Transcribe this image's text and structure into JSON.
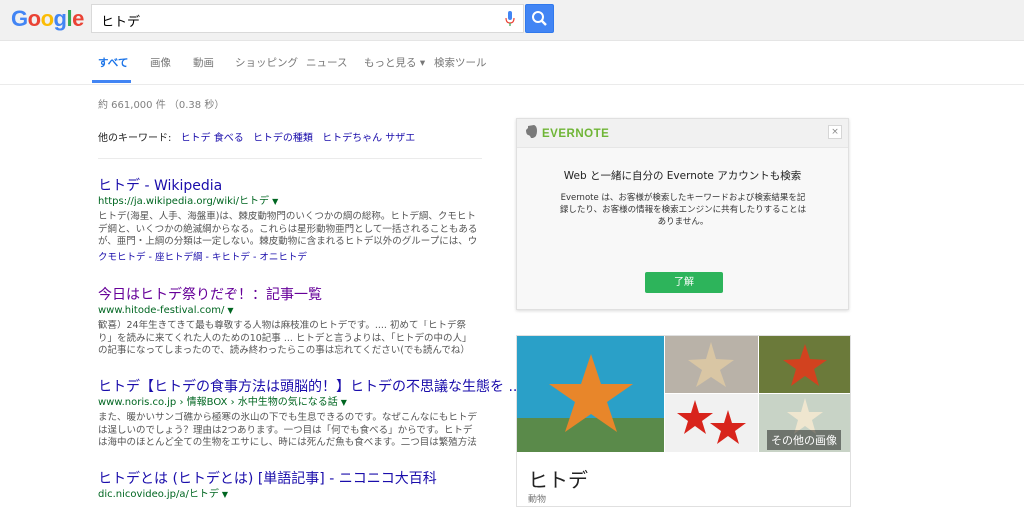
{
  "logo_letters": [
    "G",
    "o",
    "o",
    "g",
    "l",
    "e"
  ],
  "search": {
    "query": "ヒトデ"
  },
  "tabs": [
    {
      "label": "すべて"
    },
    {
      "label": "画像"
    },
    {
      "label": "動画"
    },
    {
      "label": "ショッピング"
    },
    {
      "label": "ニュース"
    },
    {
      "label": "もっと見る ▾"
    },
    {
      "label": "検索ツール"
    }
  ],
  "stats": "約 661,000 件 （0.38 秒）",
  "related": {
    "label": "他のキーワード:",
    "items": [
      "ヒトデ 食べる",
      "ヒトデの種類",
      "ヒトデちゃん サザエ"
    ]
  },
  "results": [
    {
      "title": "ヒトデ - Wikipedia",
      "url": "https://ja.wikipedia.org/wiki/ヒトデ",
      "snippet": "ヒトデ(海星、人手、海盤車)は、棘皮動物門のいくつかの綱の総称。ヒトデ綱、クモヒトデ綱と、いくつかの絶滅綱からなる。これらは星形動物亜門として一括されることもあるが、亜門・上綱の分類は一定しない。棘皮動物に含まれるヒトデ以外のグループには、ウニ ...",
      "sublinks": "クモヒトデ - 座ヒトデ綱 - キヒトデ - オニヒトデ"
    },
    {
      "title": "今日はヒトデ祭りだぞ！：記事一覧",
      "url": "www.hitode-festival.com/",
      "snippet": "歓喜）24年生きてきて最も尊敬する人物は麻枝准のヒトデです。.... 初めて「ヒトデ祭り」を読みに来てくれた人のための10記事 ... ヒトデと言うよりは、「ヒトデの中の人」の記事になってしまったので、読み終わったらこの事は忘れてください(でも読んでね）界隈 ...",
      "sublinks": ""
    },
    {
      "title": "ヒトデ【ヒトデの食事方法は頭脳的！】ヒトデの不思議な生態を ...",
      "url": "www.noris.co.jp › 情報BOX › 水中生物の気になる話",
      "snippet": "また、暖かいサンゴ礁から極寒の氷山の下でも生息できるのです。なぜこんなにもヒトデは逞しいのでしょう？理由は2つあります。一つ目は「何でも食べる」からです。ヒトデは海中のほとんど全ての生物をエサにし、時には死んだ魚も食べます。二つ目は繁殖方法 ...",
      "sublinks": ""
    },
    {
      "title": "ヒトデとは (ヒトデとは) [単語記事] - ニコニコ大百科",
      "url": "dic.nicovideo.jp/a/ヒトデ",
      "snippet": "",
      "sublinks": ""
    }
  ],
  "evernote": {
    "logo": "EVERNOTE",
    "close": "×",
    "title": "Web と一緒に自分の Evernote アカウントも検索",
    "body": "Evernote は、お客様が検索したキーワードおよび検索結果を記録したり、お客様の情報を検索エンジンに共有したりすることはありません。",
    "button": "了解"
  },
  "knowledge_panel": {
    "more_images": "その他の画像",
    "title": "ヒトデ",
    "subtitle": "動物"
  },
  "colors": {
    "accent": "#4285f4",
    "link": "#1a0dab",
    "url": "#006621",
    "evernote_green": "#2db45b"
  }
}
